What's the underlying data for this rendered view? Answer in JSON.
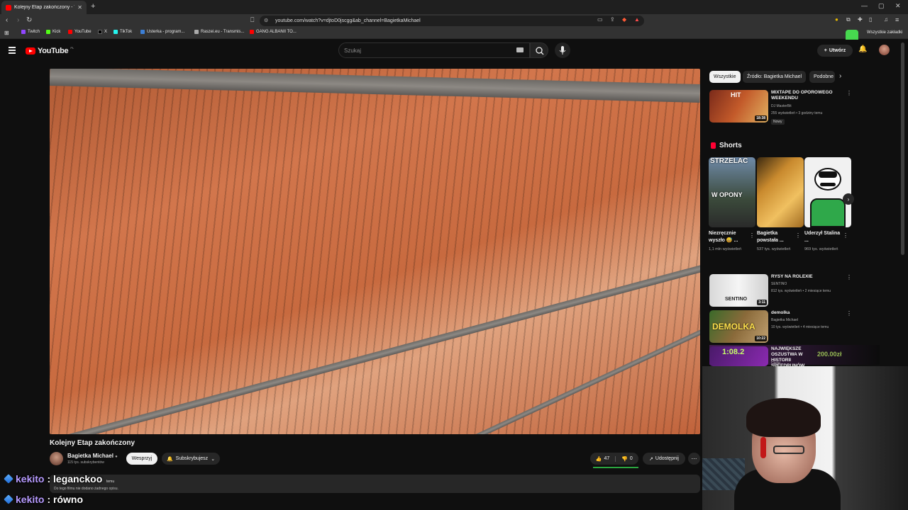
{
  "browser": {
    "tab_title": "Kolejny Etap zakończony - YouTube",
    "url": "youtube.com/watch?v=djtoD0jscgg&ab_channel=BagietkaMichael",
    "bookmarks": [
      "Twitch",
      "Kick",
      "YouTube",
      "X",
      "TikTok",
      "Usterka - program...",
      "Raszei.eu - Transmis...",
      "GANG ALBANII TO..."
    ],
    "bookmarks_right": "Wszystkie zakładki"
  },
  "header": {
    "logo": "YouTube",
    "region": "PL",
    "search_placeholder": "Szukaj",
    "create_label": "Utwórz"
  },
  "video": {
    "title": "Kolejny Etap zakończony",
    "channel": "Bagietka Michael",
    "subscribers": "115 tys. subskrybentów",
    "support_label": "Wesprzyj",
    "subscribed_label": "Subskrybujesz",
    "likes": "47",
    "dislikes": "0",
    "share_label": "Udostępnij",
    "desc_time": "temu",
    "desc_text": "Do tego filmu nie dodano żadnego opisu."
  },
  "sidebar": {
    "chips": [
      "Wszystkie",
      "Źródło: Bagietka Michael",
      "Podobne"
    ],
    "top_video": {
      "title": "MIXTAPE DO OPOROWEGO WEEKENDU",
      "channel": "DJ MasterBit",
      "meta": "255 wyświetleń • 3 godziny temu",
      "badge": "Nowy",
      "duration": "18:38",
      "thumb_text": "HIT"
    },
    "shorts_label": "Shorts",
    "shorts": [
      {
        "title": "Niezręcznie wyszło 😅 ...",
        "meta": "1,1 mln wyświetleń",
        "thumb_text_top": "STRZELAĆ",
        "thumb_text_mid": "W OPONY"
      },
      {
        "title": "Bagietka powstała ...",
        "meta": "537 tys. wyświetleń"
      },
      {
        "title": "Uderzył Stalina ...",
        "meta": "969 tys. wyświetleń"
      }
    ],
    "videos": [
      {
        "title": "RYSY NA ROLEXIE",
        "channel": "SENTINO",
        "meta": "812 tys. wyświetleń • 2 miesiące temu",
        "duration": "3:11",
        "thumb_text": "SENTINO"
      },
      {
        "title": "demolka",
        "channel": "Bagietka Michael",
        "meta": "10 tys. wyświetleń • 4 miesiące temu",
        "duration": "10:22",
        "thumb_text": "DEMOLKA"
      },
      {
        "title": "NAJWIĘKSZE OSZUSTWA W HISTORII SPEEDRUNÓW",
        "channel": "Gierki",
        "duration": "",
        "thumb_text": "1:08.2"
      }
    ],
    "promo_text": "200.00zł"
  },
  "chat": [
    {
      "user": "kekito",
      "msg": "leganckoo"
    },
    {
      "user": "kekito",
      "msg": "równo"
    }
  ],
  "colors": {
    "bg": "#0f0f0f",
    "accent_red": "#ff0000",
    "chip_bg": "#272727",
    "chat_user": "#b79bff",
    "like_bar": "#2ba640"
  }
}
